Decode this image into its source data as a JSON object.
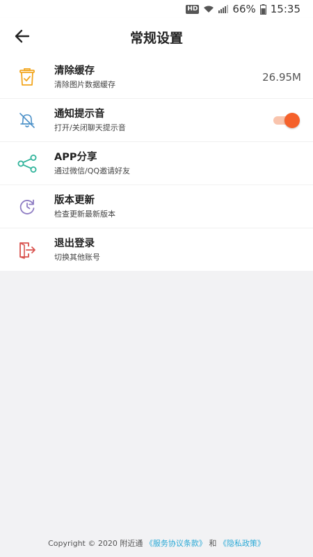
{
  "status_bar": {
    "hd": "HD",
    "battery_percent": "66%",
    "time": "15:35"
  },
  "header": {
    "title": "常规设置",
    "back_icon": "arrow-left-icon"
  },
  "settings": [
    {
      "title": "清除缓存",
      "subtitle": "清除图片数据缓存",
      "value": "26.95M",
      "icon": "trash-clipboard-icon",
      "color": "#f2a51c"
    },
    {
      "title": "通知提示音",
      "subtitle": "打开/关闭聊天提示音",
      "toggle_on": true,
      "icon": "bell-off-icon",
      "color": "#4a90c8"
    },
    {
      "title": "APP分享",
      "subtitle": "通过微信/QQ邀请好友",
      "icon": "share-icon",
      "color": "#2fb39a"
    },
    {
      "title": "版本更新",
      "subtitle": "检查更新最新版本",
      "icon": "refresh-clock-icon",
      "color": "#8e7cc3"
    },
    {
      "title": "退出登录",
      "subtitle": "切换其他账号",
      "icon": "logout-icon",
      "color": "#d9534f"
    }
  ],
  "toggle_colors": {
    "track": "#f9c4ad",
    "thumb": "#f5612b"
  },
  "footer": {
    "copyright": "Copyright © 2020 附近通",
    "service_link": "《服务协议条款》",
    "conjunction": "和",
    "privacy_link": "《隐私政策》",
    "link_color": "#2aa9d6"
  }
}
